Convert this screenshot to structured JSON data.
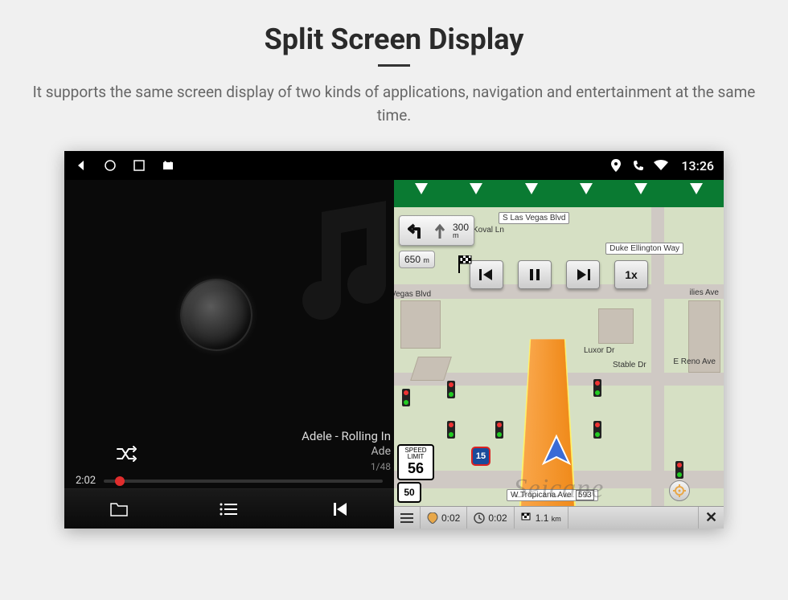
{
  "header": {
    "title": "Split Screen Display",
    "subtitle": "It supports the same screen display of two kinds of applications, navigation and entertainment at the same time."
  },
  "status_bar": {
    "time": "13:26",
    "icons": [
      "location",
      "phone",
      "wifi"
    ]
  },
  "music": {
    "track_title": "Adele - Rolling In",
    "artist": "Ade",
    "track_index": "1/48",
    "elapsed": "2:02",
    "bottom_icons": [
      "folder-icon",
      "list-icon",
      "prev-icon"
    ]
  },
  "nav": {
    "top_street": "S Las Vegas Blvd",
    "turn1_distance": "300",
    "turn1_unit": "m",
    "turn2_distance": "650",
    "turn2_unit": "m",
    "speed_limit_label": "SPEED LIMIT",
    "speed_limit_value": "56",
    "route_number": "50",
    "interstate": "15",
    "playback_speed": "1x",
    "streets": {
      "duke": "Duke Ellington Way",
      "reno": "E Reno Ave",
      "luxor": "Luxor Dr",
      "stable": "Stable Dr",
      "koval": "Koval Ln",
      "vegas_blvd": "Vegas Blvd",
      "tropicana": "W Tropicana Ave",
      "tropicana_num": "593",
      "ilies": "ilies Ave"
    },
    "bottom": {
      "time1": "0:02",
      "time2": "0:02",
      "dist": "1.1",
      "dist_unit": "km"
    }
  },
  "watermark": "Seicane"
}
